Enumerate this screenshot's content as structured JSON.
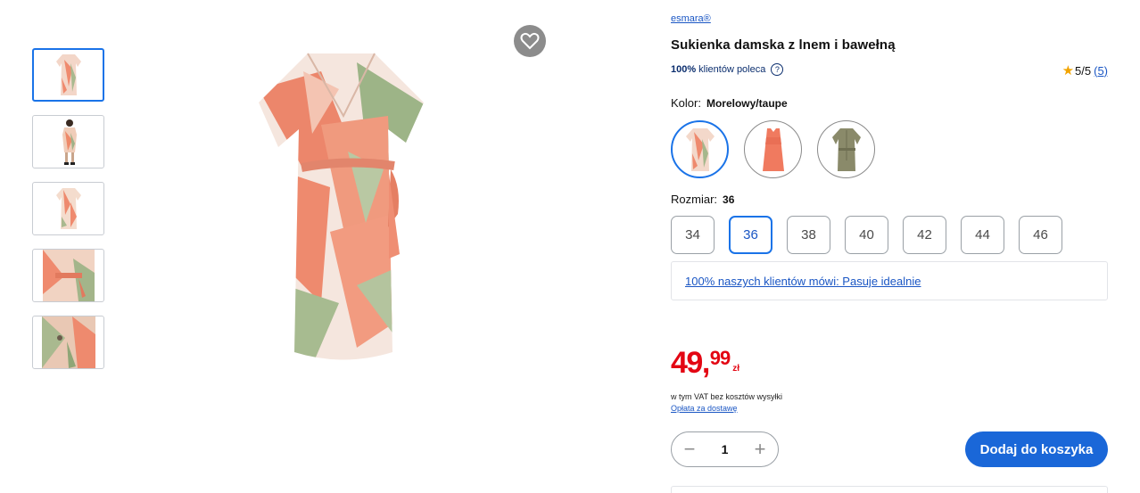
{
  "product": {
    "brand": "esmara®",
    "title": "Sukienka damska z lnem i bawełną",
    "recommend_bold": "100%",
    "recommend_text": "klientów poleca",
    "rating_text": "5/5",
    "rating_count": "(5)"
  },
  "colors": {
    "label": "Kolor:",
    "selected": "Morelowy/taupe",
    "options": [
      {
        "name": "Morelowy/taupe",
        "icon": "printed-dress"
      },
      {
        "name": "Morelowy",
        "icon": "coral-dress"
      },
      {
        "name": "Taupe",
        "icon": "olive-dress"
      }
    ]
  },
  "sizes": {
    "label": "Rozmiar:",
    "selected": "36",
    "options": [
      "34",
      "36",
      "38",
      "40",
      "42",
      "44",
      "46"
    ]
  },
  "fit_text": "100% naszych klientów mówi: Pasuje idealnie",
  "price": {
    "main": "49,",
    "decimals": "99",
    "currency": "zł",
    "vat_note": "w tym VAT bez kosztów wysyłki",
    "shipping_link": "Opłata za dostawę"
  },
  "cart": {
    "quantity": "1",
    "minus": "−",
    "plus": "+",
    "add_label": "Dodaj do koszyka"
  },
  "colors_palette": {
    "accent": "#1a73e8",
    "price_red": "#e30613",
    "button_blue": "#1a67d8"
  }
}
